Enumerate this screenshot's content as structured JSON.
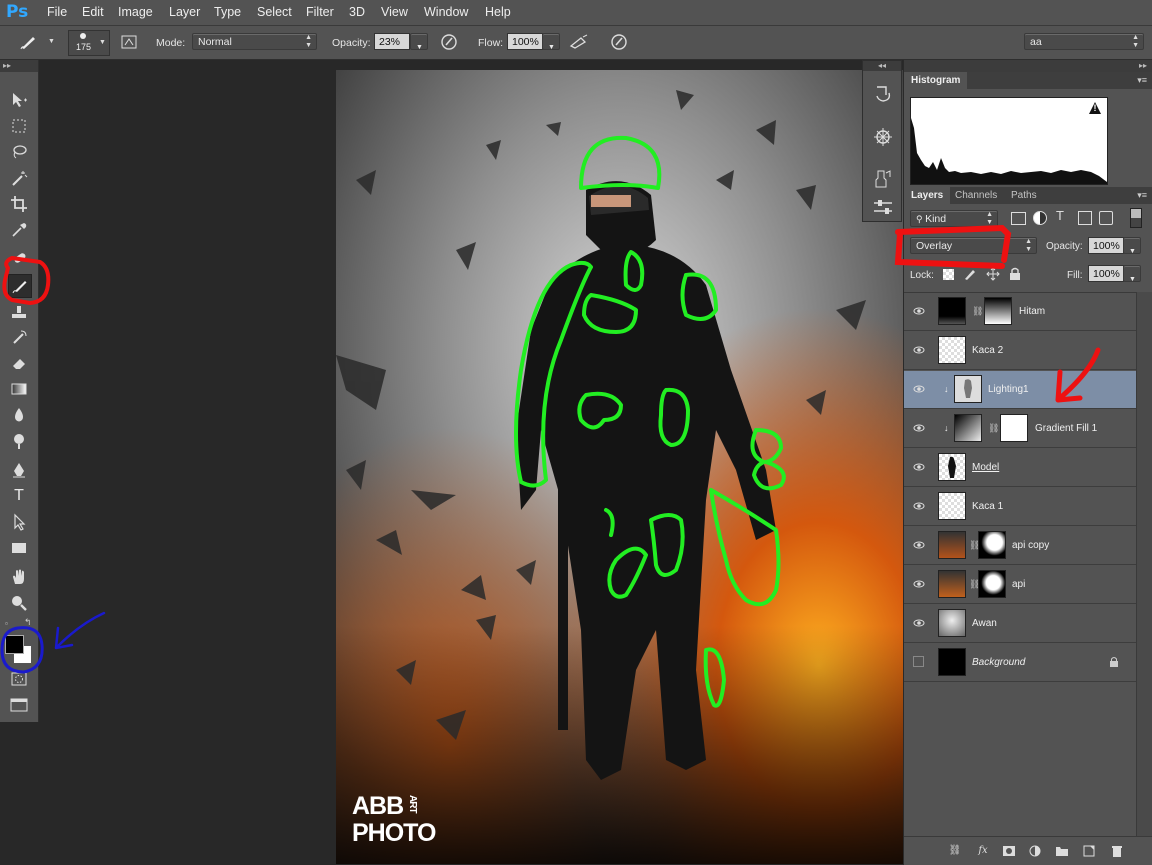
{
  "app": {
    "logo": "Ps"
  },
  "menu": [
    "File",
    "Edit",
    "Image",
    "Layer",
    "Type",
    "Select",
    "Filter",
    "3D",
    "View",
    "Window",
    "Help"
  ],
  "options": {
    "brush_size": "175",
    "mode_label": "Mode:",
    "mode_value": "Normal",
    "opacity_label": "Opacity:",
    "opacity_value": "23%",
    "flow_label": "Flow:",
    "flow_value": "100%",
    "workspace_value": "aa"
  },
  "panels": {
    "histogram_tab": "Histogram",
    "warning_glyph": "!",
    "tabs": [
      "Layers",
      "Channels",
      "Paths"
    ],
    "kind_label": "Kind",
    "blend_mode": "Overlay",
    "opacity_label": "Opacity:",
    "opacity_value": "100%",
    "lock_label": "Lock:",
    "fill_label": "Fill:",
    "fill_value": "100%"
  },
  "layers": [
    {
      "name": "Hitam",
      "visible": true,
      "selected": false
    },
    {
      "name": "Kaca 2",
      "visible": true,
      "selected": false
    },
    {
      "name": "Lighting1",
      "visible": true,
      "selected": true
    },
    {
      "name": "Gradient Fill 1",
      "visible": true,
      "selected": false
    },
    {
      "name": "Model",
      "visible": true,
      "selected": false
    },
    {
      "name": "Kaca 1",
      "visible": true,
      "selected": false
    },
    {
      "name": "api copy",
      "visible": true,
      "selected": false
    },
    {
      "name": "api",
      "visible": true,
      "selected": false
    },
    {
      "name": "Awan",
      "visible": true,
      "selected": false
    },
    {
      "name": "Background",
      "visible": false,
      "selected": false
    }
  ],
  "watermark": {
    "line1": "ABB",
    "vertical": "ART",
    "line2": "PHOTO"
  },
  "colors": {
    "annotation_green": "#22ee22",
    "annotation_red": "#ee1111",
    "annotation_blue": "#1a1acc",
    "selected_layer": "#7d8ea6"
  }
}
